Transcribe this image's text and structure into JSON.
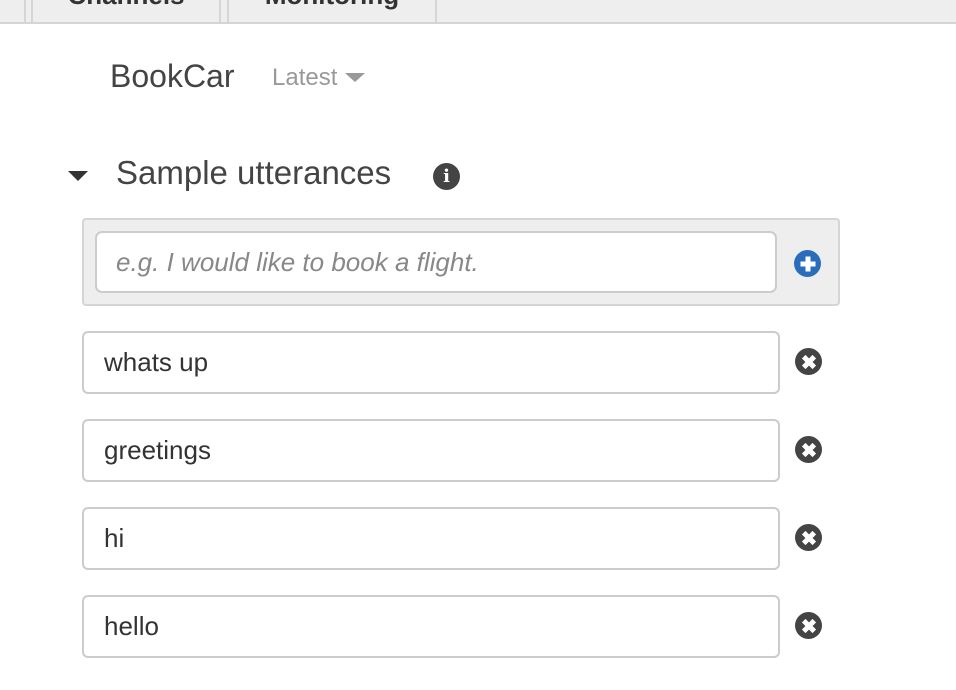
{
  "tabs": [
    {
      "label": "Channels"
    },
    {
      "label": "Monitoring"
    }
  ],
  "bot": {
    "name": "BookCar",
    "version": "Latest"
  },
  "section": {
    "title": "Sample utterances"
  },
  "new_utterance": {
    "placeholder": "e.g. I would like to book a flight.",
    "value": ""
  },
  "utterances": [
    "whats up",
    "greetings",
    "hi",
    "hello"
  ],
  "colors": {
    "accent": "#2a6ebb",
    "text": "#444444"
  }
}
